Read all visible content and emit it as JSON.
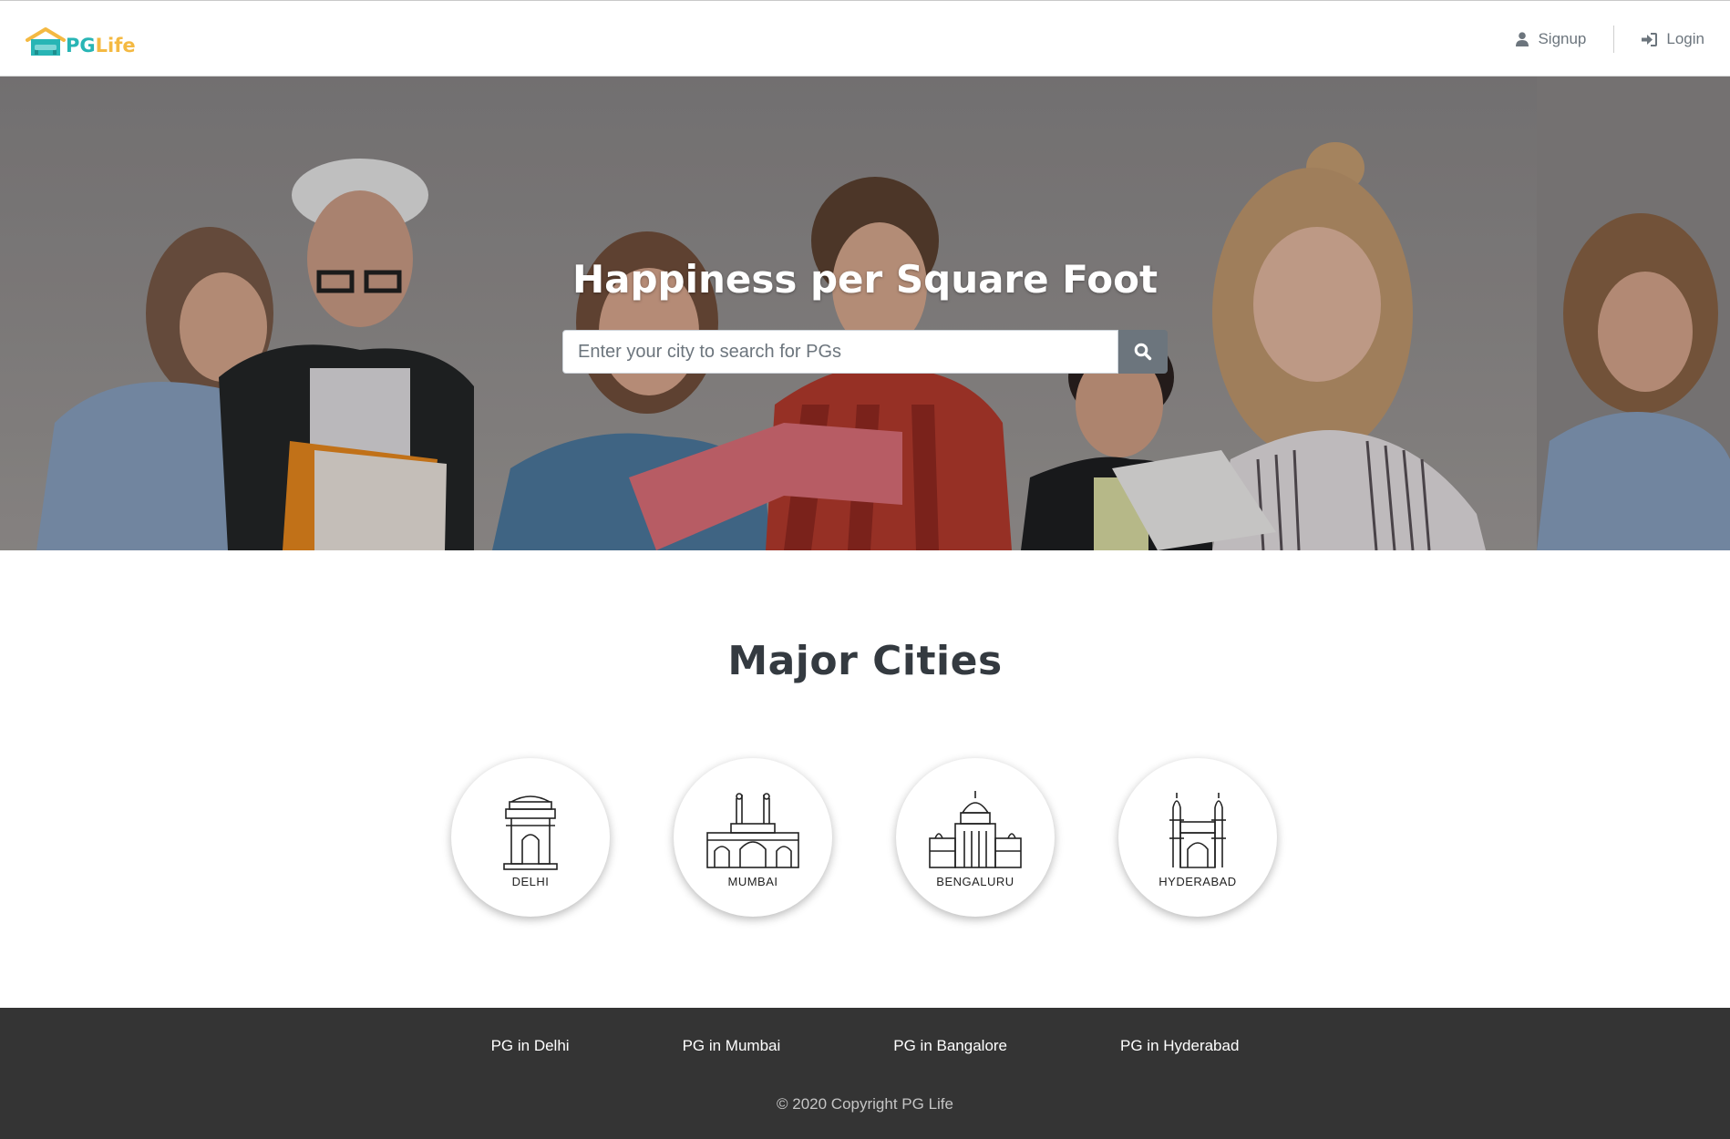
{
  "header": {
    "logo_text_pg": "PG",
    "logo_text_life": "Life",
    "signup_label": "Signup",
    "login_label": "Login"
  },
  "hero": {
    "title": "Happiness per Square Foot",
    "search_placeholder": "Enter your city to search for PGs",
    "search_value": ""
  },
  "cities_section": {
    "title": "Major Cities",
    "cities": [
      {
        "label": "DELHI",
        "icon": "india-gate-icon"
      },
      {
        "label": "MUMBAI",
        "icon": "gateway-of-india-icon"
      },
      {
        "label": "BENGALURU",
        "icon": "vidhana-soudha-icon"
      },
      {
        "label": "HYDERABAD",
        "icon": "charminar-icon"
      }
    ]
  },
  "footer": {
    "links": [
      "PG in Delhi",
      "PG in Mumbai",
      "PG in Bangalore",
      "PG in Hyderabad"
    ],
    "copyright": "© 2020 Copyright PG Life"
  },
  "colors": {
    "brand_teal": "#28b5b5",
    "brand_yellow": "#f4b942",
    "footer_bg": "#343434",
    "search_button": "#6c757d"
  }
}
